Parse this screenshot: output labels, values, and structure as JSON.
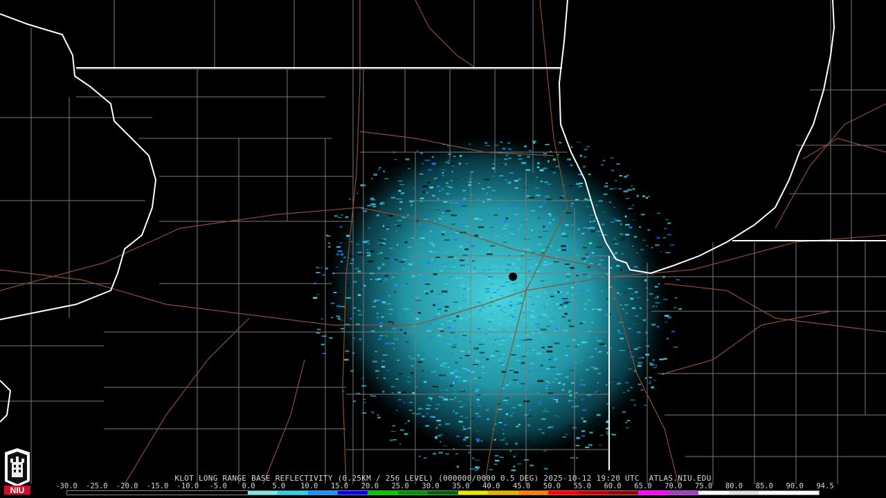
{
  "product_line": "KLOT LONG RANGE BASE REFLECTIVITY (0.25KM / 256 LEVEL) (000000/0000 0.5 DEG) 2025-10-12 19:20 UTC  ATLAS.NIU.EDU",
  "logo": {
    "text": "NIU",
    "icon": "niu-tower-logo",
    "color": "#c8102e"
  },
  "scale": {
    "labels": [
      "-30.0",
      "-25.0",
      "-20.0",
      "-15.0",
      "-10.0",
      "-5.0",
      "0.0",
      "5.0",
      "10.0",
      "15.0",
      "20.0",
      "25.0",
      "30.0",
      "35.0",
      "40.0",
      "45.0",
      "50.0",
      "55.0",
      "60.0",
      "65.0",
      "70.0",
      "75.0",
      "80.0",
      "85.0",
      "90.0",
      "94.5"
    ],
    "colors": [
      "#000000",
      "#000000",
      "#000000",
      "#000000",
      "#000000",
      "#000000",
      "#7fe5e5",
      "#2fd0e8",
      "#1e90ff",
      "#0000e0",
      "#00c800",
      "#009000",
      "#006000",
      "#e8e800",
      "#e8b000",
      "#ff8000",
      "#ff0000",
      "#c00000",
      "#900000",
      "#ff00ff",
      "#a040c0",
      "#ffffff",
      "#e0e0e0",
      "#ffffff",
      "#ffffff"
    ]
  },
  "colors": {
    "background": "#000000",
    "state_border": "#ffffff",
    "county_line": "#7a7a7a",
    "highway": "#8a5030",
    "echo_light": "#3fd8e6",
    "echo_dark": "#1aa0c8",
    "echo_blue": "#1e78ff"
  }
}
